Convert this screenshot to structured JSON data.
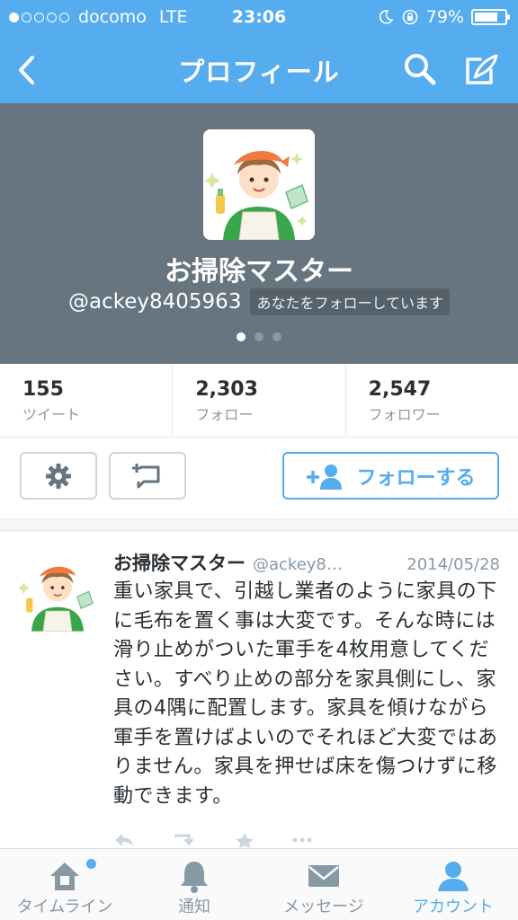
{
  "status_bar": {
    "carrier": "docomo",
    "network": "LTE",
    "time": "23:06",
    "battery": "79%",
    "signal_bars_filled": 1,
    "signal_bars_total": 5,
    "battery_level": 0.79
  },
  "nav": {
    "title": "プロフィール",
    "back_icon": "chevron-left-icon",
    "search_icon": "search-icon",
    "compose_icon": "compose-icon"
  },
  "profile": {
    "name": "お掃除マスター",
    "handle": "@ackey8405963",
    "follows_you": "あなたをフォローしています",
    "header_color": "#66757f",
    "page_count": 3,
    "active_page": 1
  },
  "stats": [
    {
      "value": "155",
      "label": "ツイート"
    },
    {
      "value": "2,303",
      "label": "フォロー"
    },
    {
      "value": "2,547",
      "label": "フォロワー"
    }
  ],
  "actions": {
    "settings_icon": "gear-icon",
    "list_icon": "add-to-list-icon",
    "follow_label": "フォローする",
    "follow_icon": "add-user-icon"
  },
  "tweet": {
    "name": "お掃除マスター",
    "handle": "@ackey8…",
    "date": "2014/05/28",
    "text": "重い家具で、引越し業者のように家具の下に毛布を置く事は大変です。そんな時には滑り止めがついた軍手を4枚用意してください。すべり止めの部分を家具側にし、家具の4隅に配置します。家具を傾けながら軍手を置けばよいのでそれほど大変ではありません。家具を押せば床を傷つけずに移動できます。"
  },
  "tabbar": [
    {
      "label": "タイムライン",
      "icon": "home-icon",
      "active": false,
      "has_dot": true
    },
    {
      "label": "通知",
      "icon": "bell-icon",
      "active": false,
      "has_dot": false
    },
    {
      "label": "メッセージ",
      "icon": "envelope-icon",
      "active": false,
      "has_dot": false
    },
    {
      "label": "アカウント",
      "icon": "person-icon",
      "active": true,
      "has_dot": false
    }
  ],
  "colors": {
    "accent": "#55acee",
    "header_gray": "#66757f",
    "muted": "#8899a6"
  }
}
